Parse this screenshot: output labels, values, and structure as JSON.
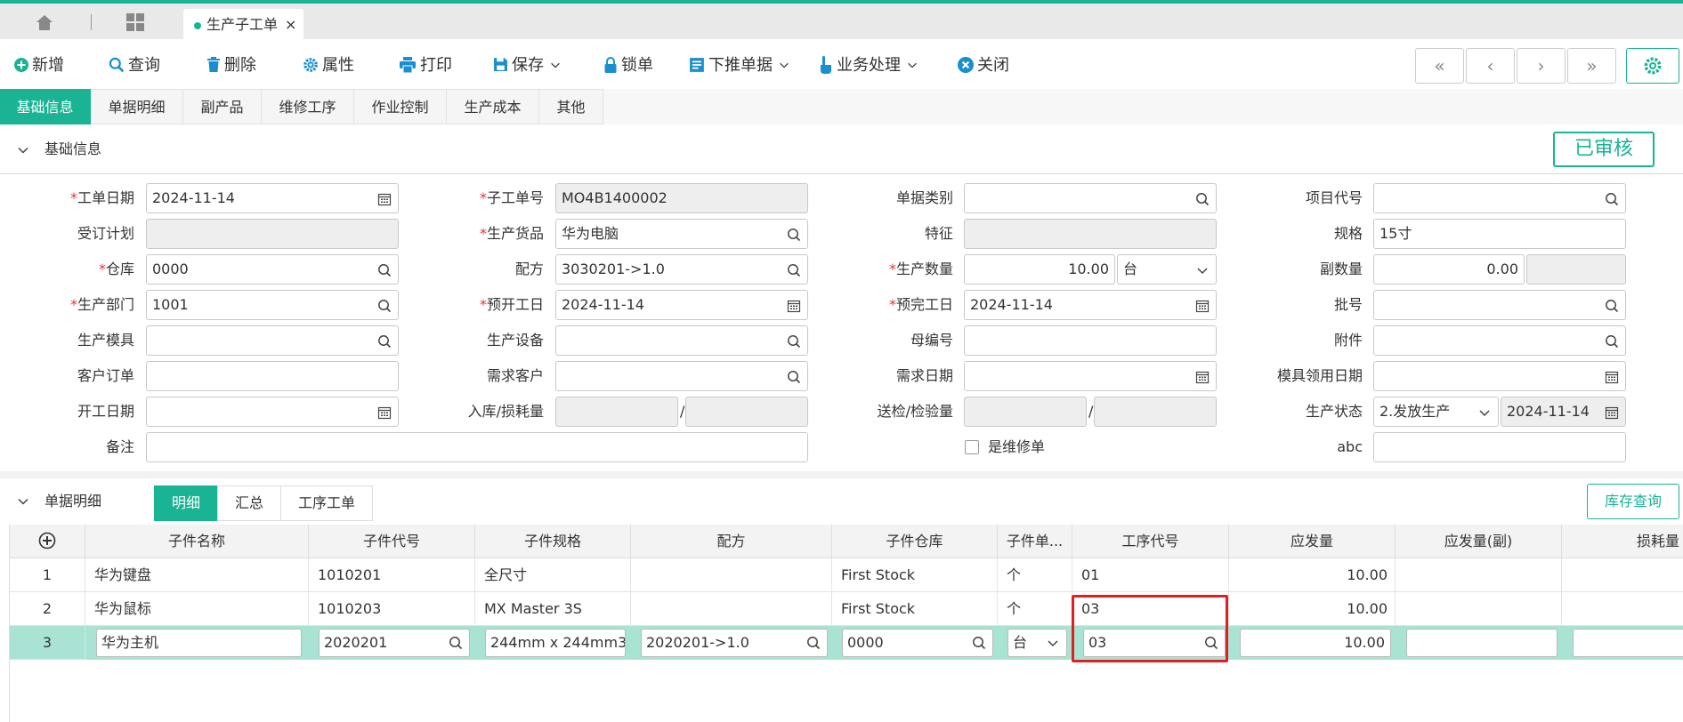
{
  "colors": {
    "accent": "#1ab394",
    "highlight": "#e02020"
  },
  "tabs": {
    "doc_tab": "生产子工单",
    "close": "×"
  },
  "toolbar": {
    "new": "新增",
    "query": "查询",
    "delete": "删除",
    "props": "属性",
    "print": "打印",
    "save": "保存",
    "lock": "锁单",
    "push": "下推单据",
    "business": "业务处理",
    "close": "关闭"
  },
  "nav": {
    "first": "«",
    "prev": "‹",
    "next": "›",
    "last": "»"
  },
  "subtabs": [
    "基础信息",
    "单据明细",
    "副产品",
    "维修工序",
    "作业控制",
    "生产成本",
    "其他"
  ],
  "section": {
    "title": "基础信息",
    "status": "已审核"
  },
  "form": {
    "order_date": {
      "label": "工单日期",
      "value": "2024-11-14"
    },
    "sub_order_no": {
      "label": "子工单号",
      "value": "MO4B1400002"
    },
    "doc_type": {
      "label": "单据类别",
      "value": ""
    },
    "project_code": {
      "label": "项目代号",
      "value": ""
    },
    "order_plan": {
      "label": "受订计划",
      "value": ""
    },
    "product": {
      "label": "生产货品",
      "value": "华为电脑"
    },
    "feature": {
      "label": "特征",
      "value": ""
    },
    "spec": {
      "label": "规格",
      "value": "15寸"
    },
    "warehouse": {
      "label": "仓库",
      "value": "0000"
    },
    "formula": {
      "label": "配方",
      "value": "3030201->1.0"
    },
    "quantity": {
      "label": "生产数量",
      "value": "10.00",
      "unit": "台"
    },
    "sub_quantity": {
      "label": "副数量",
      "value": "0.00"
    },
    "dept": {
      "label": "生产部门",
      "value": "1001"
    },
    "plan_start": {
      "label": "预开工日",
      "value": "2024-11-14"
    },
    "plan_end": {
      "label": "预完工日",
      "value": "2024-11-14"
    },
    "batch": {
      "label": "批号",
      "value": ""
    },
    "mold": {
      "label": "生产模具",
      "value": ""
    },
    "equipment": {
      "label": "生产设备",
      "value": ""
    },
    "parent_no": {
      "label": "母编号",
      "value": ""
    },
    "attachment": {
      "label": "附件",
      "value": ""
    },
    "customer_order": {
      "label": "客户订单",
      "value": ""
    },
    "demand_customer": {
      "label": "需求客户",
      "value": ""
    },
    "demand_date": {
      "label": "需求日期",
      "value": ""
    },
    "mold_date": {
      "label": "模具领用日期",
      "value": ""
    },
    "start_date": {
      "label": "开工日期",
      "value": ""
    },
    "stock_loss": {
      "label": "入库/损耗量",
      "sep": "/"
    },
    "inspect": {
      "label": "送检/检验量",
      "sep": "/"
    },
    "prod_status": {
      "label": "生产状态",
      "value": "2.发放生产",
      "date": "2024-11-14"
    },
    "remark": {
      "label": "备注",
      "value": ""
    },
    "repair": {
      "label": "是维修单"
    },
    "abc": {
      "label": "abc",
      "value": ""
    }
  },
  "detail": {
    "title": "单据明细",
    "tabs": [
      "明细",
      "汇总",
      "工序工单"
    ],
    "stock_btn": "库存查询",
    "columns": [
      "子件名称",
      "子件代号",
      "子件规格",
      "配方",
      "子件仓库",
      "子件单...",
      "工序代号",
      "应发量",
      "应发量(副)",
      "损耗量"
    ],
    "rows": [
      {
        "no": "1",
        "name": "华为键盘",
        "code": "1010201",
        "spec": "全尺寸",
        "formula": "",
        "wh": "First Stock",
        "unit": "个",
        "proc": "01",
        "qty": "10.00"
      },
      {
        "no": "2",
        "name": "华为鼠标",
        "code": "1010203",
        "spec": "MX Master 3S",
        "formula": "",
        "wh": "First Stock",
        "unit": "个",
        "proc": "03",
        "qty": "10.00"
      },
      {
        "no": "3",
        "name": "华为主机",
        "code": "2020201",
        "spec": "244mm x 244mm3",
        "formula": "2020201->1.0",
        "wh": "0000",
        "unit": "台",
        "proc": "03",
        "qty": "10.00"
      }
    ]
  }
}
